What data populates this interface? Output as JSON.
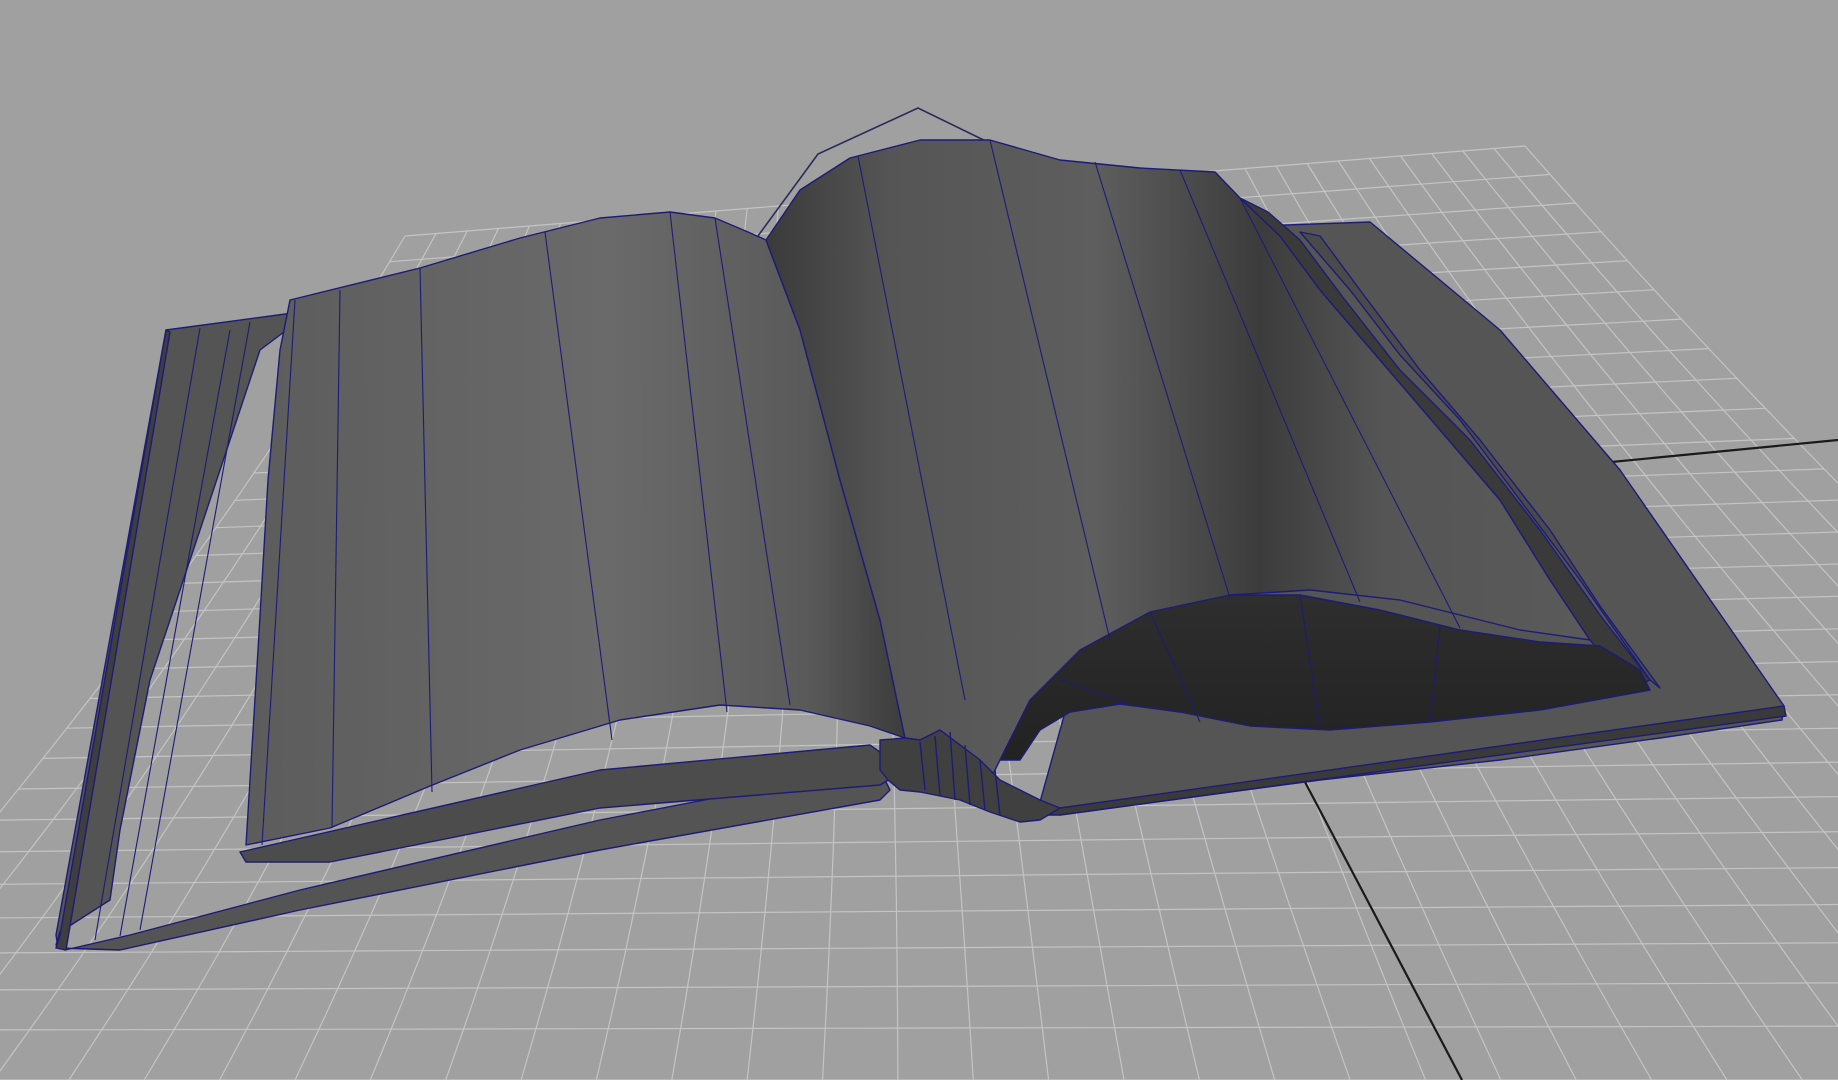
{
  "viewport": {
    "background_color": "#a0a0a0",
    "grid_color": "#c4c4c4",
    "axis_color": "#1a1a1a",
    "wire_color": "#1c1c78",
    "curve_color": "#2a2a5a"
  },
  "scene": {
    "object": "open-book-model",
    "shading": "smooth-shade-with-wireframe",
    "shade_colors": {
      "light": "#6a6a6a",
      "mid": "#545454",
      "dark": "#333333",
      "darkest": "#262626"
    },
    "icons": [
      "book-mesh-icon",
      "ground-grid-icon",
      "nurbs-curve-icon"
    ]
  }
}
